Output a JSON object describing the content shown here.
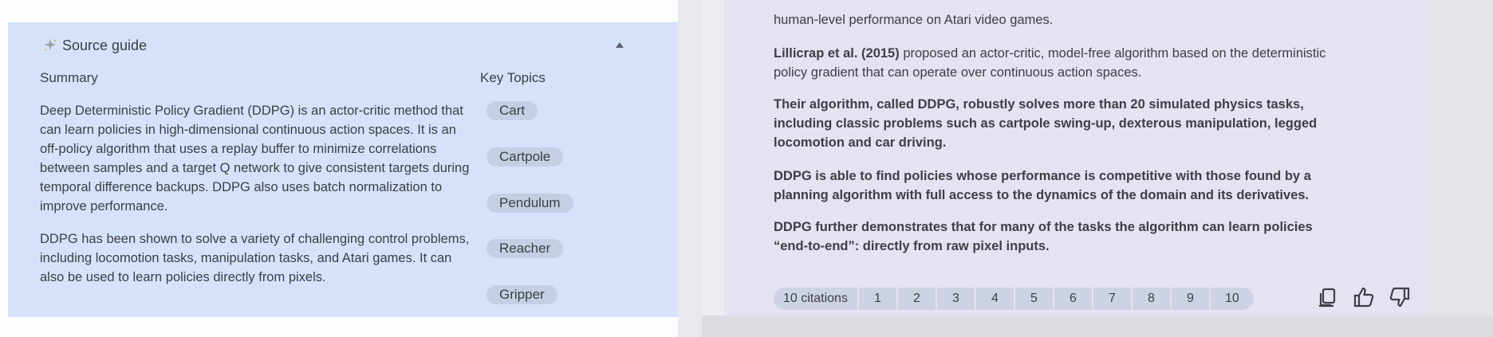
{
  "source_guide": {
    "title": "Source guide",
    "summary_heading": "Summary",
    "key_topics_heading": "Key Topics",
    "summary_paragraphs": [
      "Deep Deterministic Policy Gradient (DDPG) is an actor-critic method that can learn policies in high-dimensional continuous action spaces. It is an off-policy algorithm that uses a replay buffer to minimize correlations between samples and a target Q network to give consistent targets during temporal difference backups. DDPG also uses batch normalization to improve performance.",
      "DDPG has been shown to solve a variety of challenging control problems, including locomotion tasks, manipulation tasks, and Atari games. It can also be used to learn policies directly from pixels."
    ],
    "key_topics": [
      "Cart",
      "Cartpole",
      "Pendulum",
      "Reacher",
      "Gripper"
    ],
    "icons": {
      "sparkle": "sparkle-icon",
      "collapse": "chevron-up-icon"
    }
  },
  "response": {
    "line0": "human-level performance on Atari video games.",
    "p1_bold": "Lillicrap et al. (2015)",
    "p1_rest": " proposed an actor-critic, model-free algorithm based on the deterministic policy gradient that can operate over continuous action spaces.",
    "p2": "Their algorithm, called DDPG, robustly solves more than 20 simulated physics tasks, including classic problems such as cartpole swing-up, dexterous manipulation, legged locomotion and car driving.",
    "p3": "DDPG is able to find policies whose performance is competitive with those found by a planning algorithm with full access to the dynamics of the domain and its derivatives.",
    "p4": "DDPG further demonstrates that for many of the tasks the algorithm can learn policies “end-to-end”: directly from raw pixel inputs."
  },
  "citations": {
    "label": "10 citations",
    "numbers": [
      "1",
      "2",
      "3",
      "4",
      "5",
      "6",
      "7",
      "8",
      "9",
      "10"
    ]
  },
  "actions": [
    "copy-icon",
    "thumbs-up-icon",
    "thumbs-down-icon"
  ],
  "colors": {
    "source_guide_bg": "#d6e2fc",
    "chip_bg": "#c4cfe4",
    "response_bg": "#e6e2f2",
    "citation_bg": "#cdd3e3"
  }
}
